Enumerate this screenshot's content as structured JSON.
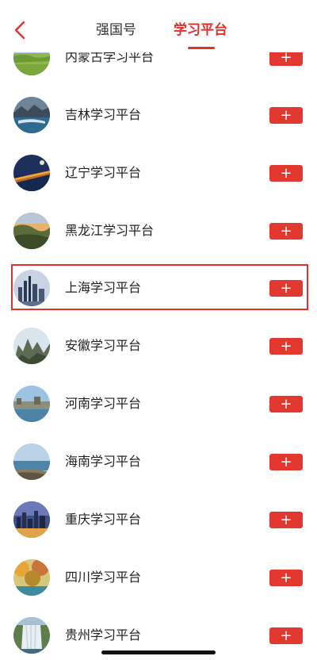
{
  "header": {
    "tabs": [
      {
        "label": "强国号",
        "active": false
      },
      {
        "label": "学习平台",
        "active": true
      }
    ],
    "accent_color": "#e0312b"
  },
  "platforms": [
    {
      "name": "内蒙古学习平台",
      "button": "+",
      "image": "grassland"
    },
    {
      "name": "吉林学习平台",
      "button": "+",
      "image": "lake-mountains"
    },
    {
      "name": "辽宁学习平台",
      "button": "+",
      "image": "bridge-night"
    },
    {
      "name": "黑龙江学习平台",
      "button": "+",
      "image": "sunset-valley"
    },
    {
      "name": "上海学习平台",
      "button": "+",
      "image": "city-skyline",
      "highlighted": true
    },
    {
      "name": "安徽学习平台",
      "button": "+",
      "image": "mountain-peaks"
    },
    {
      "name": "河南学习平台",
      "button": "+",
      "image": "river-town"
    },
    {
      "name": "海南学习平台",
      "button": "+",
      "image": "sea-coast"
    },
    {
      "name": "重庆学习平台",
      "button": "+",
      "image": "city-dusk"
    },
    {
      "name": "四川学习平台",
      "button": "+",
      "image": "autumn-forest"
    },
    {
      "name": "贵州学习平台",
      "button": "+",
      "image": "waterfall"
    }
  ]
}
